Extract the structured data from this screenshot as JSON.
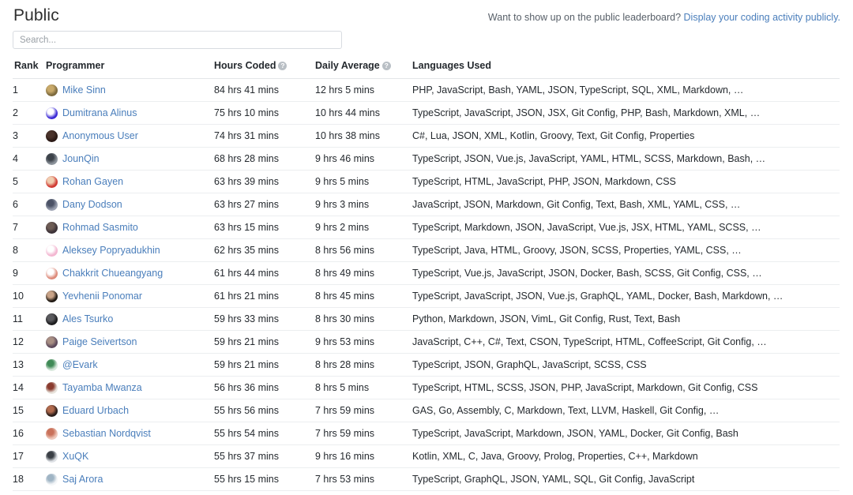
{
  "header": {
    "title": "Public",
    "promo_text": "Want to show up on the public leaderboard?",
    "promo_link": "Display your coding activity publicly."
  },
  "search": {
    "placeholder": "Search...",
    "value": ""
  },
  "table": {
    "columns": {
      "rank": "Rank",
      "programmer": "Programmer",
      "hours_coded": "Hours Coded",
      "daily_average": "Daily Average",
      "languages_used": "Languages Used"
    },
    "help_glyph": "?",
    "rows": [
      {
        "rank": "1",
        "name": "Mike Sinn",
        "hours": "84 hrs 41 mins",
        "average": "12 hrs 5 mins",
        "languages": "PHP, JavaScript, Bash, YAML, JSON, TypeScript, SQL, XML, Markdown, …",
        "avatar_color": "#7d6a3e",
        "avatar_accent": "#c8a96a"
      },
      {
        "rank": "2",
        "name": "Dumitrana Alinus",
        "hours": "75 hrs 10 mins",
        "average": "10 hrs 44 mins",
        "languages": "TypeScript, JavaScript, JSON, JSX, Git Config, PHP, Bash, Markdown, XML, …",
        "avatar_color": "#3b2ad6",
        "avatar_accent": "#ffffff"
      },
      {
        "rank": "3",
        "name": "Anonymous User",
        "hours": "74 hrs 31 mins",
        "average": "10 hrs 38 mins",
        "languages": "C#, Lua, JSON, XML, Kotlin, Groovy, Text, Git Config, Properties",
        "avatar_color": "#2b1a16",
        "avatar_accent": "#4a332b"
      },
      {
        "rank": "4",
        "name": "JounQin",
        "hours": "68 hrs 28 mins",
        "average": "9 hrs 46 mins",
        "languages": "TypeScript, JSON, Vue.js, JavaScript, YAML, HTML, SCSS, Markdown, Bash, …",
        "avatar_color": "#8d949c",
        "avatar_accent": "#3c4249"
      },
      {
        "rank": "5",
        "name": "Rohan Gayen",
        "hours": "63 hrs 39 mins",
        "average": "9 hrs 5 mins",
        "languages": "TypeScript, HTML, JavaScript, PHP, JSON, Markdown, CSS",
        "avatar_color": "#d03a33",
        "avatar_accent": "#f0cdb0"
      },
      {
        "rank": "6",
        "name": "Dany Dodson",
        "hours": "63 hrs 27 mins",
        "average": "9 hrs 3 mins",
        "languages": "JavaScript, JSON, Markdown, Git Config, Text, Bash, XML, YAML, CSS, …",
        "avatar_color": "#9aa0b0",
        "avatar_accent": "#4b5266"
      },
      {
        "rank": "7",
        "name": "Rohmad Sasmito",
        "hours": "63 hrs 15 mins",
        "average": "9 hrs 2 mins",
        "languages": "TypeScript, Markdown, JSON, JavaScript, Vue.js, JSX, HTML, YAML, SCSS, …",
        "avatar_color": "#3c3238",
        "avatar_accent": "#6d5c55"
      },
      {
        "rank": "8",
        "name": "Aleksey Popryadukhin",
        "hours": "62 hrs 35 mins",
        "average": "8 hrs 56 mins",
        "languages": "TypeScript, Java, HTML, Groovy, JSON, SCSS, Properties, YAML, CSS, …",
        "avatar_color": "#f3b6d1",
        "avatar_accent": "#ffffff"
      },
      {
        "rank": "9",
        "name": "Chakkrit Chueangyang",
        "hours": "61 hrs 44 mins",
        "average": "8 hrs 49 mins",
        "languages": "TypeScript, Vue.js, JavaScript, JSON, Docker, Bash, SCSS, Git Config, CSS, …",
        "avatar_color": "#dd8a7a",
        "avatar_accent": "#ffffff"
      },
      {
        "rank": "10",
        "name": "Yevhenii Ponomar",
        "hours": "61 hrs 21 mins",
        "average": "8 hrs 45 mins",
        "languages": "TypeScript, JavaScript, JSON, Vue.js, GraphQL, YAML, Docker, Bash, Markdown, …",
        "avatar_color": "#201a14",
        "avatar_accent": "#c9a387"
      },
      {
        "rank": "11",
        "name": "Ales Tsurko",
        "hours": "59 hrs 33 mins",
        "average": "8 hrs 30 mins",
        "languages": "Python, Markdown, JSON, VimL, Git Config, Rust, Text, Bash",
        "avatar_color": "#1d1d1f",
        "avatar_accent": "#5a5a5e"
      },
      {
        "rank": "12",
        "name": "Paige Seivertson",
        "hours": "59 hrs 21 mins",
        "average": "9 hrs 53 mins",
        "languages": "JavaScript, C++, C#, Text, CSON, TypeScript, HTML, CoffeeScript, Git Config, …",
        "avatar_color": "#5d4a5c",
        "avatar_accent": "#a88f84"
      },
      {
        "rank": "13",
        "name": "@Evark",
        "hours": "59 hrs 21 mins",
        "average": "8 hrs 28 mins",
        "languages": "TypeScript, JSON, GraphQL, JavaScript, SCSS, CSS",
        "avatar_color": "#d8e8dc",
        "avatar_accent": "#3f8a56"
      },
      {
        "rank": "14",
        "name": "Tayamba Mwanza",
        "hours": "56 hrs 36 mins",
        "average": "8 hrs 5 mins",
        "languages": "TypeScript, HTML, SCSS, JSON, PHP, JavaScript, Markdown, Git Config, CSS",
        "avatar_color": "#e8e4dd",
        "avatar_accent": "#8a3b2e"
      },
      {
        "rank": "15",
        "name": "Eduard Urbach",
        "hours": "55 hrs 56 mins",
        "average": "7 hrs 59 mins",
        "languages": "GAS, Go, Assembly, C, Markdown, Text, LLVM, Haskell, Git Config, …",
        "avatar_color": "#2a1d1a",
        "avatar_accent": "#b06a4d"
      },
      {
        "rank": "16",
        "name": "Sebastian Nordqvist",
        "hours": "55 hrs 54 mins",
        "average": "7 hrs 59 mins",
        "languages": "TypeScript, JavaScript, Markdown, JSON, YAML, Docker, Git Config, Bash",
        "avatar_color": "#efc9bc",
        "avatar_accent": "#c9715a"
      },
      {
        "rank": "17",
        "name": "XuQK",
        "hours": "55 hrs 37 mins",
        "average": "9 hrs 16 mins",
        "languages": "Kotlin, XML, C, Java, Groovy, Prolog, Properties, C++, Markdown",
        "avatar_color": "#dfe2e6",
        "avatar_accent": "#3a3f45"
      },
      {
        "rank": "18",
        "name": "Saj Arora",
        "hours": "55 hrs 15 mins",
        "average": "7 hrs 53 mins",
        "languages": "TypeScript, GraphQL, JSON, YAML, SQL, Git Config, JavaScript",
        "avatar_color": "#f4f6f8",
        "avatar_accent": "#9fb4c4"
      }
    ]
  },
  "colors": {
    "link": "#4a7ebb",
    "text": "#24292e",
    "muted": "#586069",
    "border": "#eceef0"
  }
}
